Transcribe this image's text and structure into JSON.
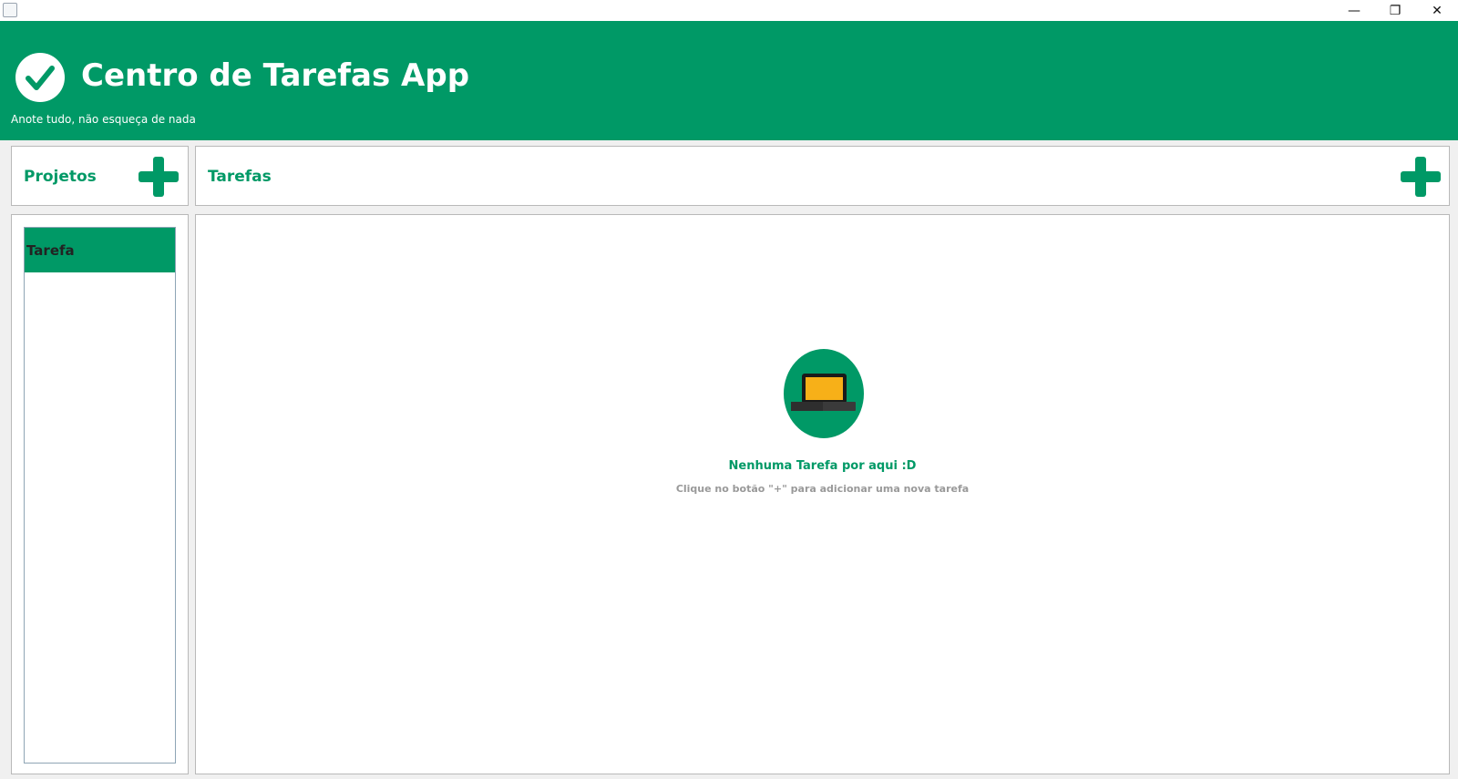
{
  "window": {
    "controls": {
      "minimize": "—",
      "maximize": "❐",
      "close": "✕"
    }
  },
  "header": {
    "title": "Centro de Tarefas App",
    "subtitle": "Anote tudo, não esqueça de nada",
    "logo_icon": "check-circle-icon"
  },
  "projects": {
    "title": "Projetos",
    "add_icon": "plus-icon",
    "items": [
      {
        "label": "Tarefa",
        "selected": true
      }
    ]
  },
  "tasks": {
    "title": "Tarefas",
    "add_icon": "plus-icon",
    "empty_state": {
      "icon": "laptop-icon",
      "title": "Nenhuma Tarefa por aqui :D",
      "subtitle": "Clique no botão \"+\" para adicionar uma nova tarefa"
    }
  },
  "colors": {
    "accent": "#009966",
    "background": "#f0f0f0",
    "panel": "#ffffff",
    "muted_text": "#999999",
    "laptop_screen": "#f7b018"
  }
}
